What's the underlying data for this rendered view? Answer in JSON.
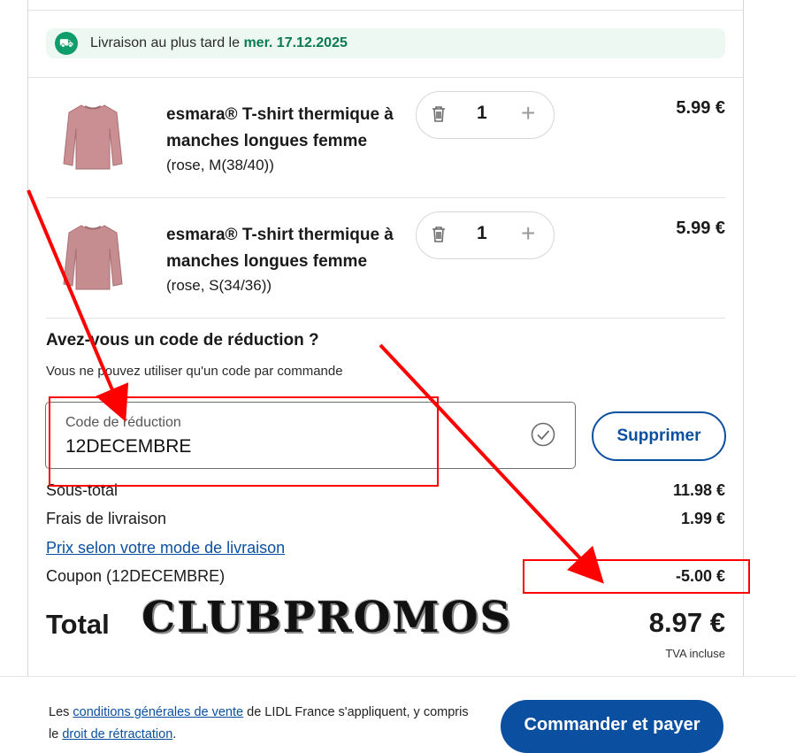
{
  "delivery": {
    "icon": "delivery-truck-icon",
    "text": "Livraison au plus tard le",
    "date": "mer. 17.12.2025"
  },
  "items": [
    {
      "name": "esmara® T-shirt thermique à manches longues femme",
      "variant": "(rose, M(38/40))",
      "quantity": "1",
      "price": "5.99 €"
    },
    {
      "name": "esmara® T-shirt thermique à manches longues femme",
      "variant": "(rose, S(34/36))",
      "quantity": "1",
      "price": "5.99 €"
    }
  ],
  "coupon": {
    "title": "Avez-vous un code de réduction ?",
    "subtitle": "Vous ne pouvez utiliser qu'un code par commande",
    "field_label": "Code de réduction",
    "field_value": "12DECEMBRE",
    "remove_label": "Supprimer"
  },
  "summary": {
    "subtotal_label": "Sous-total",
    "subtotal_value": "11.98 €",
    "shipping_label": "Frais de livraison",
    "shipping_value": "1.99 €",
    "shipping_link": "Prix selon votre mode de livraison",
    "coupon_label": "Coupon (12DECEMBRE)",
    "coupon_value": "-5.00 €",
    "total_label": "Total",
    "total_value": "8.97 €",
    "tax_note": "TVA incluse"
  },
  "watermark": "CLUBPROMOS",
  "footer": {
    "terms_prefix": "Les",
    "terms_link": "conditions générales de vente",
    "terms_middle": "de LIDL France s'appliquent, y compris le",
    "withdrawal_link": "droit de rétractation",
    "terms_suffix": ".",
    "order_button": "Commander et payer"
  },
  "colors": {
    "brand_blue": "#0b50a0",
    "delivery_green": "#0a7a55",
    "delivery_bg": "#eef8f3",
    "annotation_red": "#ff0000",
    "product_pink": "#c98f93"
  }
}
